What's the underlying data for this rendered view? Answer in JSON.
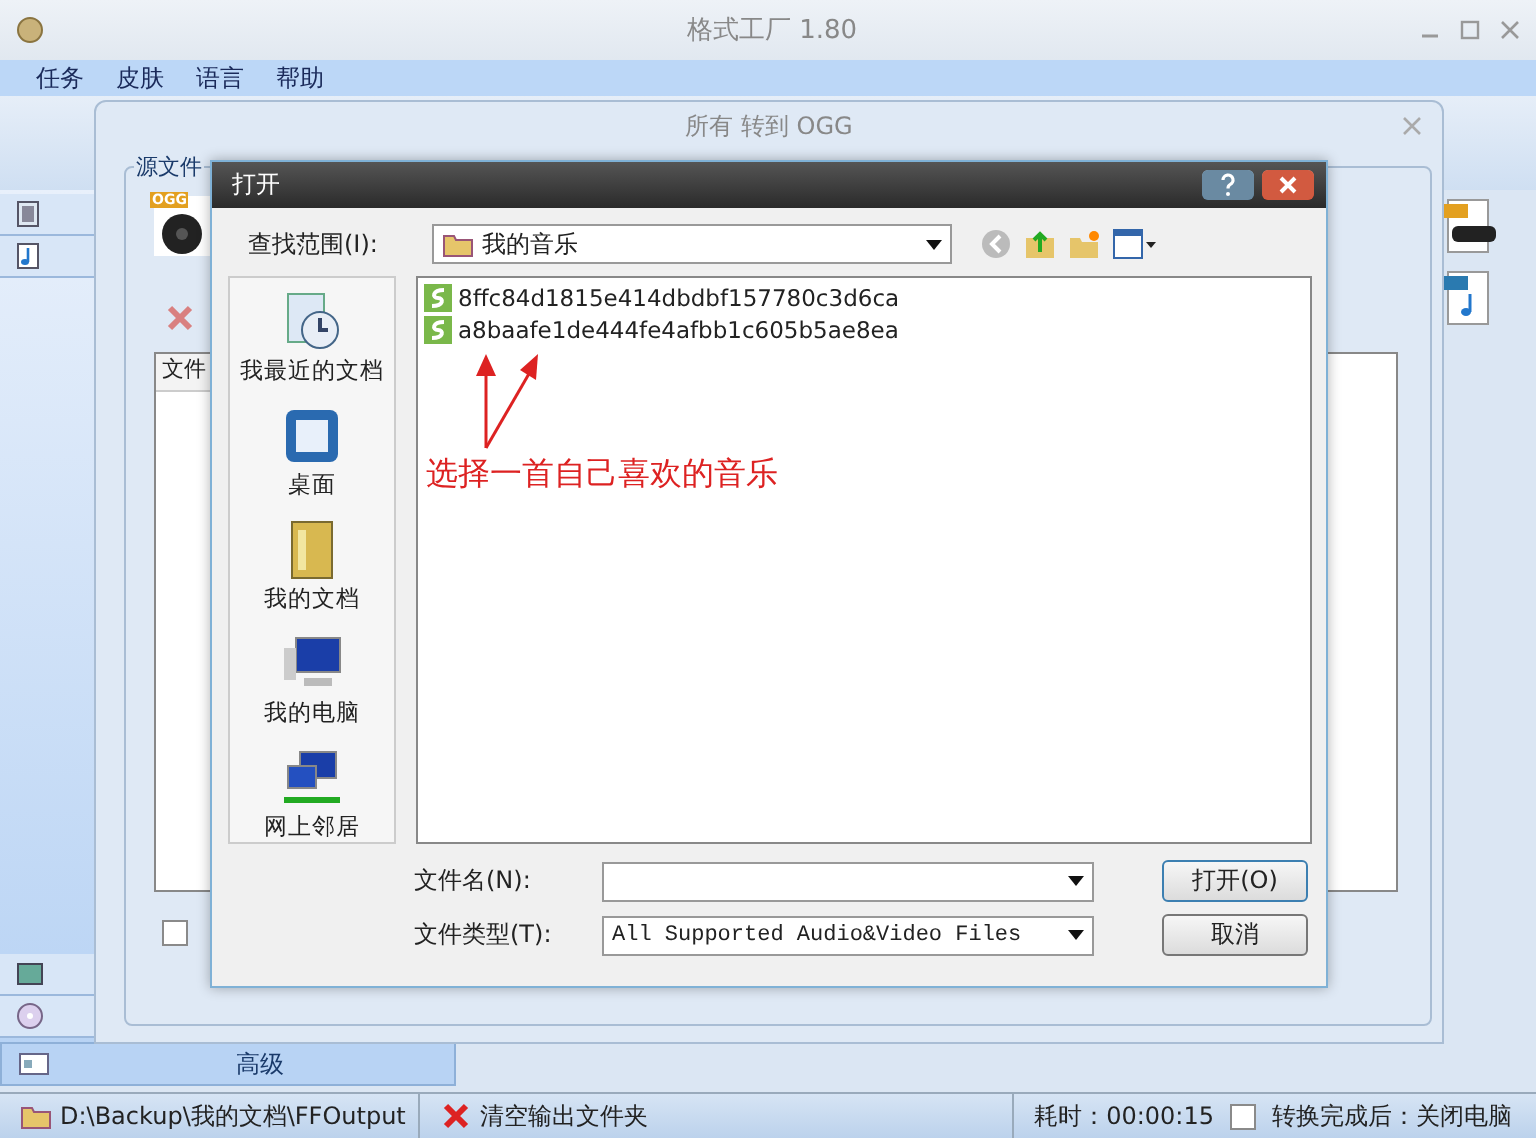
{
  "window": {
    "title": "格式工厂 1.80"
  },
  "menu": [
    "任务",
    "皮肤",
    "语言",
    "帮助"
  ],
  "sidebar": {
    "advanced_label": "高级"
  },
  "convert_dialog": {
    "title": "所有 转到 OGG",
    "group_label": "源文件",
    "format_icon_label": "OGG",
    "list_column": "文件",
    "output_checkbox": {
      "checked": false
    }
  },
  "open_dialog": {
    "title": "打开",
    "look_in_label": "查找范围(I):",
    "look_in": "我的音乐",
    "places": [
      {
        "kind": "recent",
        "label": "我最近的文档"
      },
      {
        "kind": "desktop",
        "label": "桌面"
      },
      {
        "kind": "documents",
        "label": "我的文档"
      },
      {
        "kind": "computer",
        "label": "我的电脑"
      },
      {
        "kind": "network",
        "label": "网上邻居"
      }
    ],
    "files": [
      {
        "name": "8ffc84d1815e414dbdbf157780c3d6ca",
        "selected": false
      },
      {
        "name": "a8baafe1de444fe4afbb1c605b5ae8ea",
        "selected": false
      }
    ],
    "annotation": "选择一首自己喜欢的音乐",
    "file_name_label": "文件名(N):",
    "file_type_label": "文件类型(T):",
    "file_type": "All Supported Audio&Video Files",
    "buttons": [
      "打开(O)",
      "取消"
    ]
  },
  "status_bar": {
    "output_path": "D:\\Backup\\我的文档\\FFOutput",
    "clear_button": "清空输出文件夹",
    "elapsed": "耗时：00:00:15",
    "shutdown": {
      "label": "转换完成后：关闭电脑",
      "checked": false
    }
  }
}
